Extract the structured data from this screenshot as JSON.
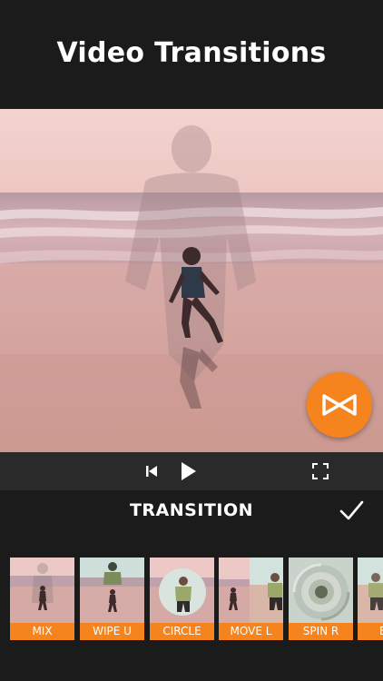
{
  "header": {
    "title": "Video Transitions"
  },
  "colors": {
    "accent": "#f5841f",
    "background": "#1b1b1b",
    "controls_bar": "#2a2a2a"
  },
  "preview": {
    "fab_icon": "bowtie-transition-icon"
  },
  "controls": {
    "prev_icon": "skip-back-icon",
    "play_icon": "play-icon",
    "fullscreen_icon": "fullscreen-icon"
  },
  "transition_panel": {
    "title": "TRANSITION",
    "done_icon": "checkmark-icon"
  },
  "transitions": [
    {
      "label": "MIX"
    },
    {
      "label": "WIPE U"
    },
    {
      "label": "CIRCLE"
    },
    {
      "label": "MOVE L"
    },
    {
      "label": "SPIN R"
    },
    {
      "label": "BLU"
    }
  ]
}
